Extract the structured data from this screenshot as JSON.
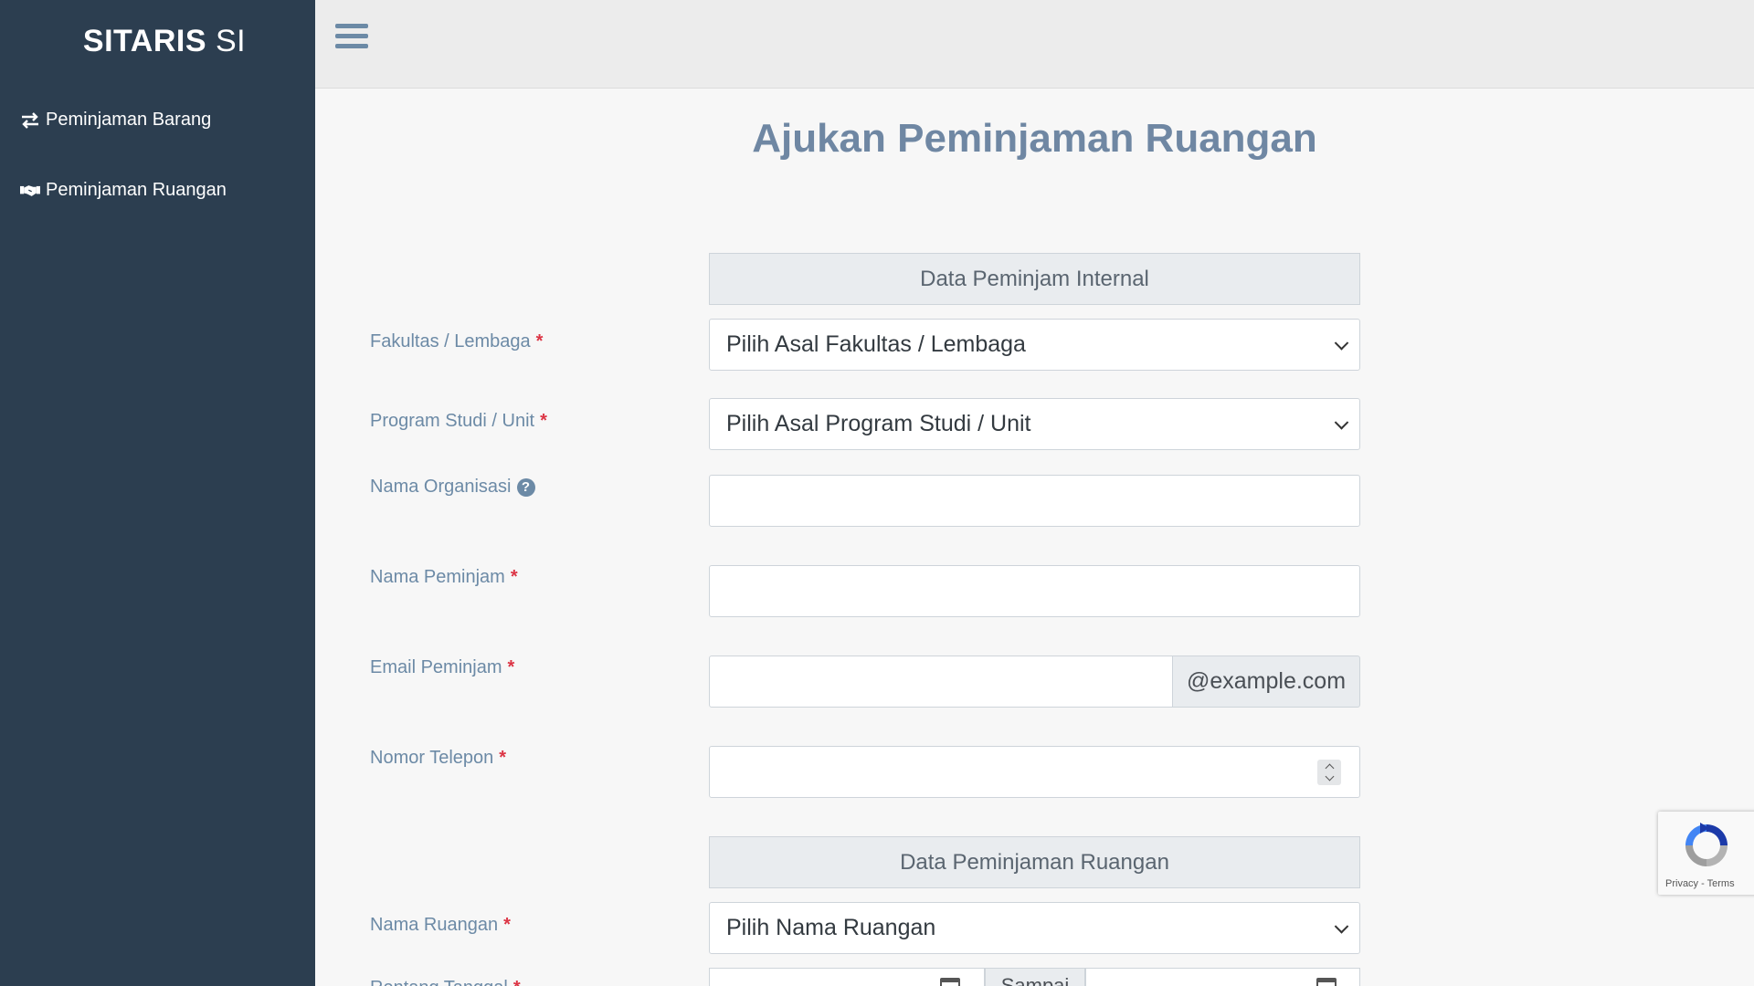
{
  "brand": {
    "bold": "SITARIS",
    "light": "SI"
  },
  "sidebar": {
    "items": [
      {
        "label": "Peminjaman Barang",
        "icon": "exchange-arrows-icon"
      },
      {
        "label": "Peminjaman Ruangan",
        "icon": "handshake-icon"
      }
    ]
  },
  "page": {
    "title": "Ajukan Peminjaman Ruangan"
  },
  "sections": {
    "internal": "Data Peminjam Internal",
    "ruangan": "Data Peminjaman Ruangan"
  },
  "form": {
    "fakultas": {
      "label": "Fakultas / Lembaga",
      "required": "*",
      "selected": "Pilih Asal Fakultas / Lembaga"
    },
    "prodi": {
      "label": "Program Studi / Unit",
      "required": "*",
      "selected": "Pilih Asal Program Studi / Unit"
    },
    "organisasi": {
      "label": "Nama Organisasi",
      "help": "?"
    },
    "peminjam": {
      "label": "Nama Peminjam",
      "required": "*"
    },
    "email": {
      "label": "Email Peminjam",
      "required": "*",
      "addon": "@example.com"
    },
    "telepon": {
      "label": "Nomor Telepon",
      "required": "*"
    },
    "ruangan": {
      "label": "Nama Ruangan",
      "required": "*",
      "selected": "Pilih Nama Ruangan"
    },
    "rentang": {
      "label": "Rentang Tanggal",
      "required": "*",
      "sampai": "Sampai"
    }
  },
  "recaptcha": {
    "links": "Privacy - Terms"
  },
  "colors": {
    "sidebar": "#2c3e50",
    "title": "#6f87a3",
    "label": "#6c8aa6",
    "required": "#dc3545"
  }
}
